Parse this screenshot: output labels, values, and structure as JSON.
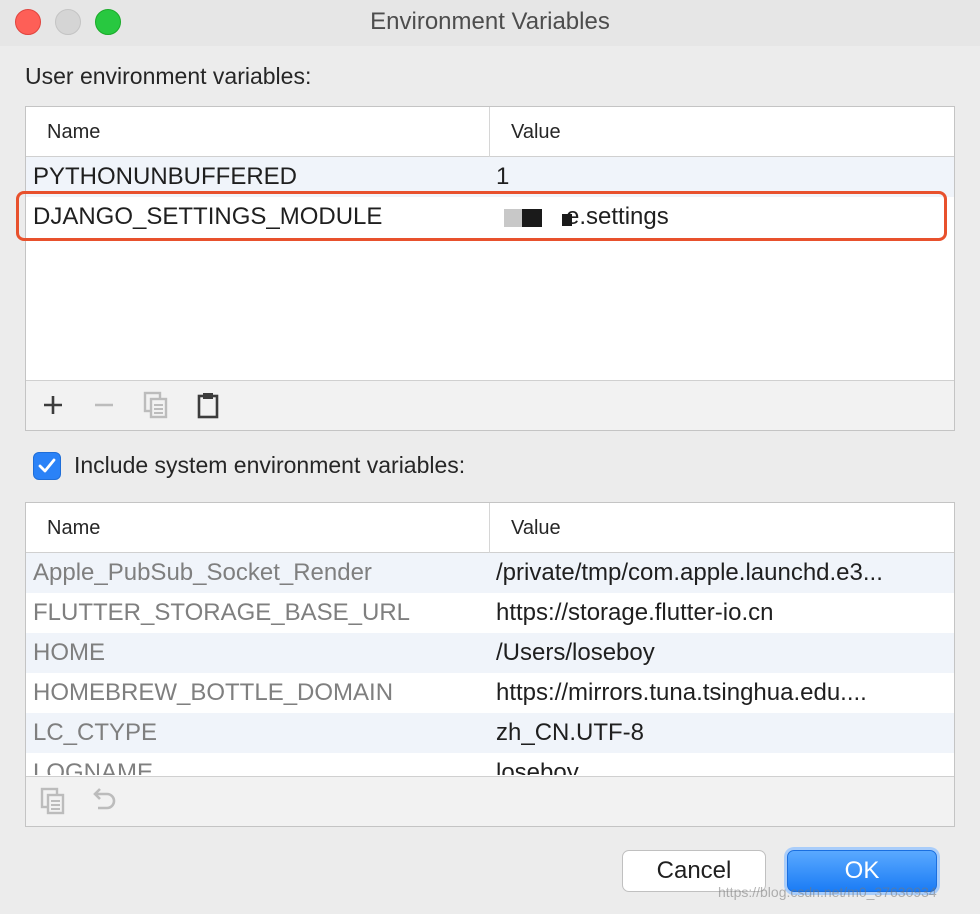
{
  "window": {
    "title": "Environment Variables"
  },
  "user_section": {
    "label": "User environment variables:",
    "columns": {
      "name": "Name",
      "value": "Value"
    },
    "rows": [
      {
        "name": "PYTHONUNBUFFERED",
        "value": "1"
      },
      {
        "name": "DJANGO_SETTINGS_MODULE",
        "value": "e.settings",
        "redacted": true
      }
    ],
    "highlight_color": "#e8512d"
  },
  "include_system": {
    "label": "Include system environment variables:",
    "checked": true
  },
  "system_section": {
    "columns": {
      "name": "Name",
      "value": "Value"
    },
    "rows": [
      {
        "name": "Apple_PubSub_Socket_Render",
        "value": "/private/tmp/com.apple.launchd.e3..."
      },
      {
        "name": "FLUTTER_STORAGE_BASE_URL",
        "value": "https://storage.flutter-io.cn"
      },
      {
        "name": "HOME",
        "value": "/Users/loseboy"
      },
      {
        "name": "HOMEBREW_BOTTLE_DOMAIN",
        "value": "https://mirrors.tuna.tsinghua.edu...."
      },
      {
        "name": "LC_CTYPE",
        "value": "zh_CN.UTF-8"
      },
      {
        "name": "LOGNAME",
        "value": "loseboy"
      }
    ]
  },
  "buttons": {
    "cancel": "Cancel",
    "ok": "OK"
  },
  "watermark": "https://blog.csdn.net/m0_37630934",
  "colors": {
    "accent": "#2a82f7",
    "alt_row": "#f0f4fa"
  }
}
